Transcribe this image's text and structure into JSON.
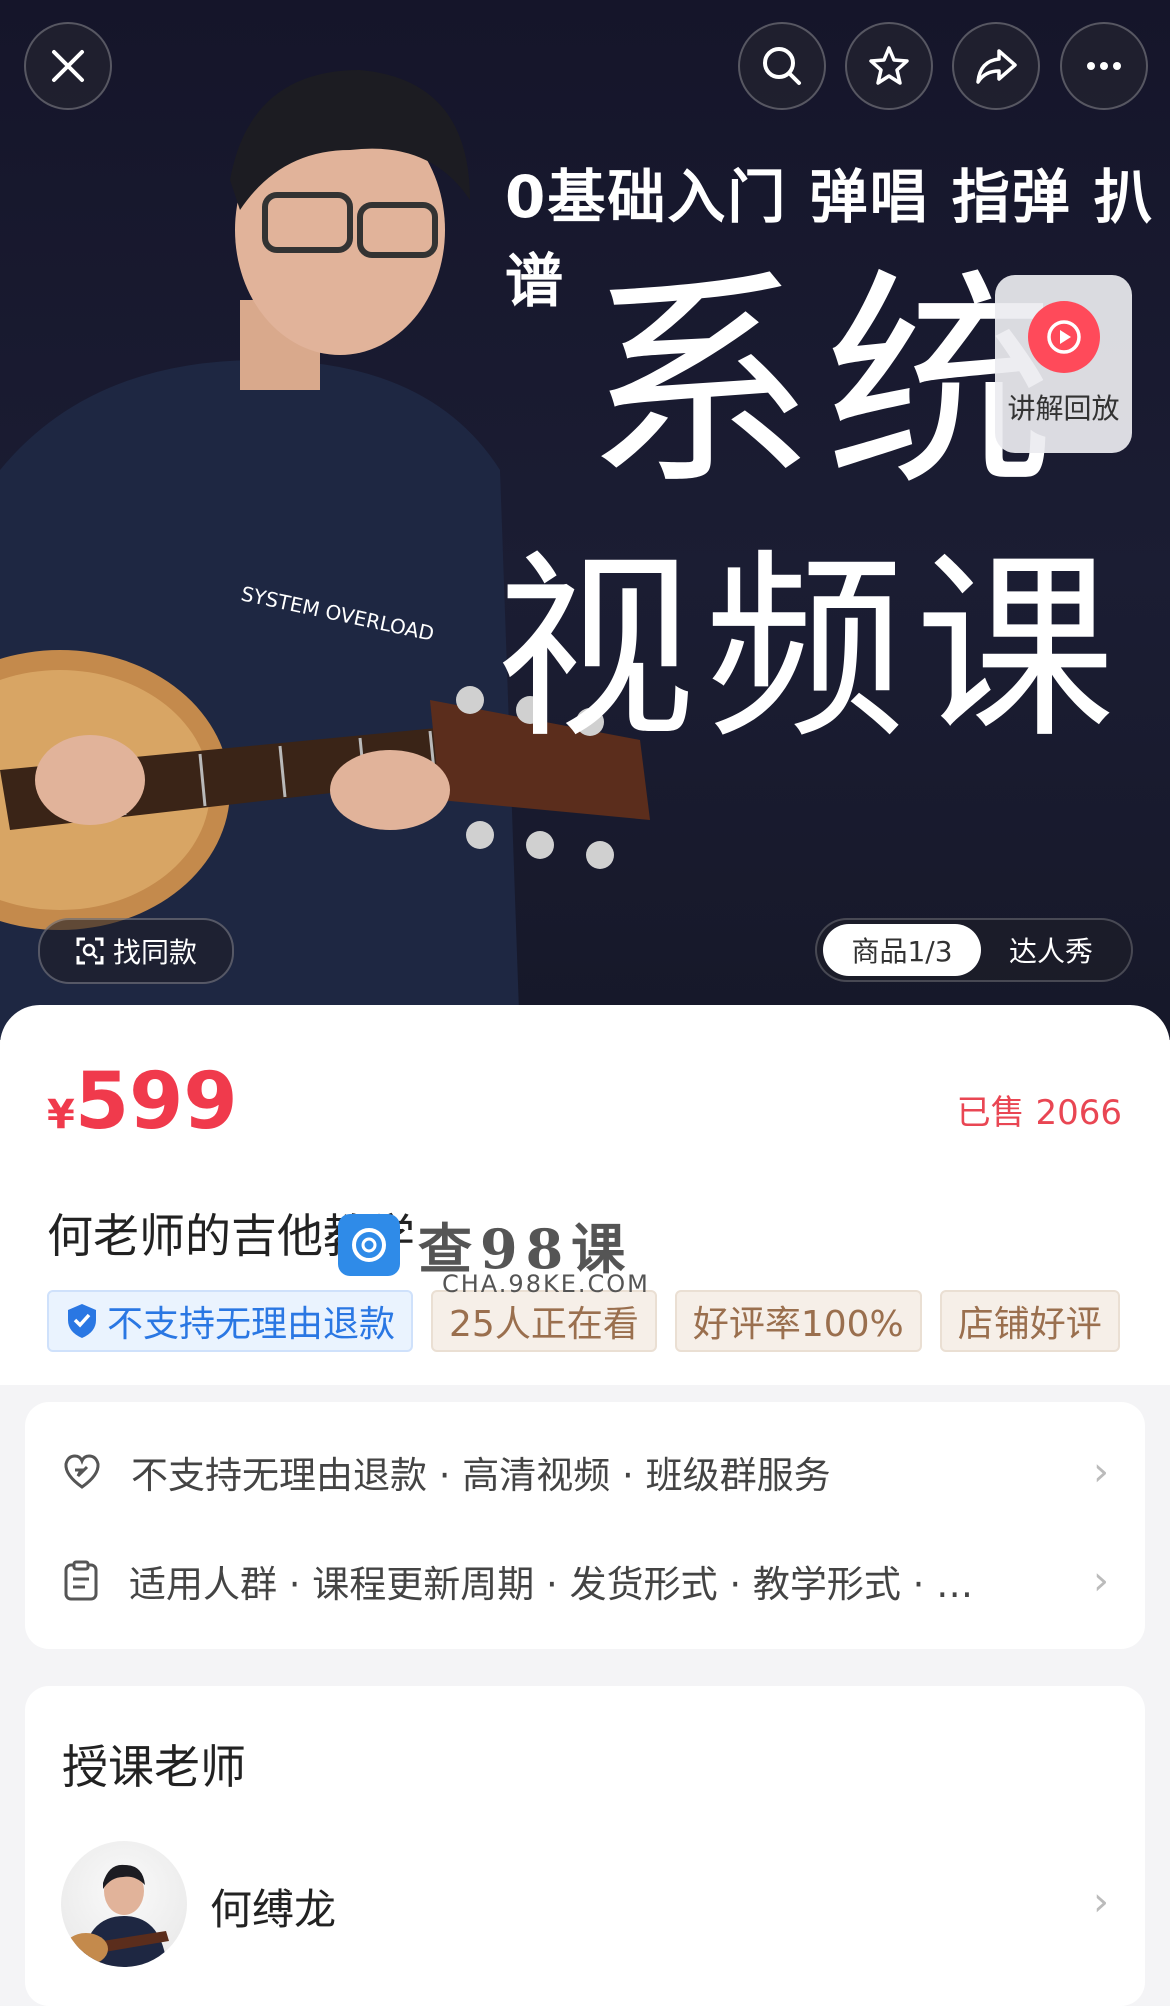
{
  "hero": {
    "subtitle": "0基础入门 弹唱 指弹 扒谱",
    "big_line1": "系统",
    "big_line2": "视频课",
    "replay_label": "讲解回放",
    "find_same_label": "找同款",
    "tabs": [
      {
        "label": "商品1/3",
        "active": true
      },
      {
        "label": "达人秀",
        "active": false
      }
    ],
    "shirt_text": "SYSTEM OVERLOAD"
  },
  "product": {
    "currency": "¥",
    "price": "599",
    "sold": "已售 2066",
    "title": "何老师的吉他教学",
    "badges": [
      {
        "label": "不支持无理由退款",
        "style": "blue"
      },
      {
        "label": "25人正在看",
        "style": "tan"
      },
      {
        "label": "好评率100%",
        "style": "tan"
      },
      {
        "label": "店铺好评",
        "style": "tan"
      }
    ]
  },
  "watermark": {
    "text": "查98课",
    "url": "CHA.98KE.COM"
  },
  "services": [
    {
      "icon": "heart-shield-icon",
      "text": "不支持无理由退款 · 高清视频 · 班级群服务"
    },
    {
      "icon": "clipboard-icon",
      "text": "适用人群 · 课程更新周期 · 发货形式 · 教学形式 · …"
    }
  ],
  "teacher": {
    "section_title": "授课老师",
    "name": "何缚龙"
  },
  "colors": {
    "accent": "#f03a4c",
    "hero_bg": "#1b1d33",
    "badge_blue": "#2a77e3"
  }
}
